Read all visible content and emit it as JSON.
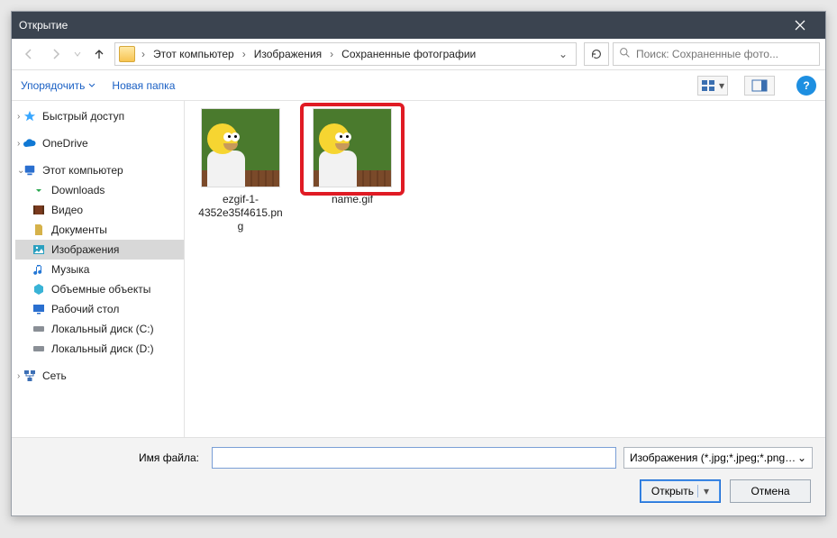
{
  "window": {
    "title": "Открытие"
  },
  "nav": {
    "crumbs": [
      "Этот компьютер",
      "Изображения",
      "Сохраненные фотографии"
    ],
    "search_placeholder": "Поиск: Сохраненные фото..."
  },
  "toolbar": {
    "organize": "Упорядочить",
    "new_folder": "Новая папка"
  },
  "tree": {
    "quick_access": "Быстрый доступ",
    "onedrive": "OneDrive",
    "this_pc": "Этот компьютер",
    "downloads": "Downloads",
    "videos": "Видео",
    "documents": "Документы",
    "pictures": "Изображения",
    "music": "Музыка",
    "objects3d": "Объемные объекты",
    "desktop": "Рабочий стол",
    "disk_c": "Локальный диск (C:)",
    "disk_d": "Локальный диск (D:)",
    "network": "Сеть"
  },
  "files": [
    {
      "name": "ezgif-1-4352e35f4615.png",
      "selected": false
    },
    {
      "name": "name.gif",
      "selected": true
    }
  ],
  "footer": {
    "filename_label": "Имя файла:",
    "filename_value": "",
    "filter_label": "Изображения (*.jpg;*.jpeg;*.png;*.gif)",
    "open": "Открыть",
    "cancel": "Отмена"
  }
}
